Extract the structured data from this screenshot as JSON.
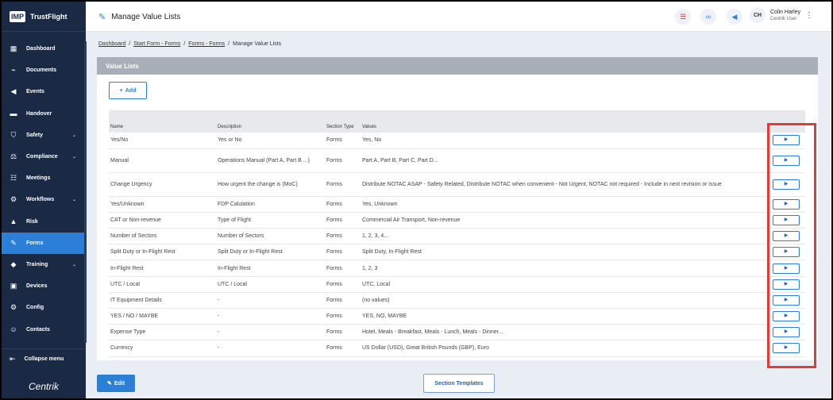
{
  "app": {
    "logo_text": "IMP",
    "brand_name": "TrustFlight",
    "vendor": "Centrik"
  },
  "sidebar": {
    "items": [
      {
        "label": "Dashboard",
        "icon": "dashboard-icon"
      },
      {
        "label": "Documents",
        "icon": "paperclip-icon"
      },
      {
        "label": "Events",
        "icon": "megaphone-icon"
      },
      {
        "label": "Handover",
        "icon": "handover-icon"
      },
      {
        "label": "Safety",
        "icon": "shield-icon",
        "chevron": "⌄"
      },
      {
        "label": "Compliance",
        "icon": "compliance-icon",
        "chevron": "⌄"
      },
      {
        "label": "Meetings",
        "icon": "meetings-icon"
      },
      {
        "label": "Workflows",
        "icon": "workflow-icon",
        "chevron": "⌄"
      },
      {
        "label": "Risk",
        "icon": "risk-icon"
      },
      {
        "label": "Forms",
        "icon": "forms-icon"
      },
      {
        "label": "Training",
        "icon": "graduation-icon",
        "chevron": "⌄"
      },
      {
        "label": "Devices",
        "icon": "devices-icon"
      },
      {
        "label": "Config",
        "icon": "config-icon"
      },
      {
        "label": "Contacts",
        "icon": "contacts-icon"
      }
    ],
    "collapse_label": "Collapse menu"
  },
  "header": {
    "title": "Manage Value Lists",
    "user_initials": "CH",
    "user_name": "Colin Harley",
    "user_role": "Centrik User"
  },
  "breadcrumb": {
    "items": [
      "Dashboard",
      "Start Form - Forms",
      "Forms - Forms"
    ],
    "current": "Manage Value Lists",
    "separator": "/"
  },
  "panel": {
    "title": "Value Lists",
    "add_label": "Add"
  },
  "table": {
    "headers": {
      "name": "Name",
      "description": "Description",
      "section_type": "Section Type",
      "values": "Values"
    },
    "rows": [
      {
        "name": "Yes/No",
        "description": "Yes or No",
        "type": "Forms",
        "values": "Yes, No"
      },
      {
        "name": "Manual",
        "description": "Operations Manual (Part A, Part B ...)",
        "type": "Forms",
        "values": "Part A, Part B, Part C, Part D..."
      },
      {
        "name": "Change Urgency",
        "description": "How urgent the change is (MoC)",
        "type": "Forms",
        "values": "Distribute NOTAC ASAP - Safety Related, Distribute NOTAC when convenient - Not Urgent, NOTAC not required - Include in next revision or issue"
      },
      {
        "name": "Yes/Unknown",
        "description": "FDP Calulation",
        "type": "Forms",
        "values": "Yes, Unknown"
      },
      {
        "name": "CAT or Non-revenue",
        "description": "Type of Flight",
        "type": "Forms",
        "values": "Commercial Air Transport, Non-revenue"
      },
      {
        "name": "Number of Sectors",
        "description": "Number of Sectors",
        "type": "Forms",
        "values": "1, 2, 3, 4..."
      },
      {
        "name": "Split Duty or In-Flight Rest",
        "description": "Split Duty or In-Flight Rest",
        "type": "Forms",
        "values": "Split Duty, In-Flight Rest"
      },
      {
        "name": "In-Flight Rest",
        "description": "In-Flight Rest",
        "type": "Forms",
        "values": "1, 2, 3"
      },
      {
        "name": "UTC / Local",
        "description": "UTC / Local",
        "type": "Forms",
        "values": "UTC, Local"
      },
      {
        "name": "IT Equipment Details",
        "description": "-",
        "type": "Forms",
        "values": "(no values)"
      },
      {
        "name": "YES / NO / MAYBE",
        "description": "-",
        "type": "Forms",
        "values": "YES, NO, MAYBE"
      },
      {
        "name": "Expense Type",
        "description": "-",
        "type": "Forms",
        "values": "Hotel, Meals - Breakfast, Meals - Lunch, Meals - Dinner..."
      },
      {
        "name": "Currency",
        "description": "-",
        "type": "Forms",
        "values": "US Dollar (USD), Great British Pounds (GBP), Euro"
      }
    ]
  },
  "footer": {
    "edit_label": "Edit",
    "templates_label": "Section Templates"
  },
  "colors": {
    "sidebar": "#1b2a44",
    "accent": "#2b7fd6",
    "highlight": "#e23b3b"
  }
}
